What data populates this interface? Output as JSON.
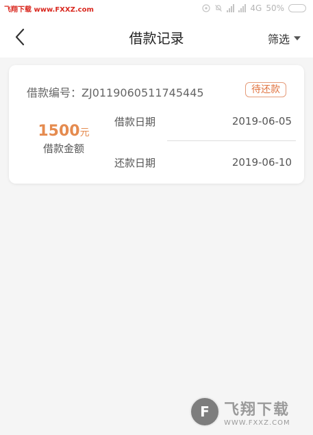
{
  "status_bar": {
    "watermark": "飞翔下载 www.FXXZ.com",
    "network": "4G",
    "battery": "50%",
    "battery_level": 0.5
  },
  "nav": {
    "title": "借款记录",
    "filter_label": "筛选"
  },
  "record": {
    "loan_no_label": "借款编号：",
    "loan_no": "ZJ0119060511745445",
    "status": "待还款",
    "amount": "1500",
    "amount_unit": "元",
    "amount_label": "借款金额",
    "loan_date_label": "借款日期",
    "loan_date": "2019-06-05",
    "repay_date_label": "还款日期",
    "repay_date": "2019-06-10"
  },
  "watermark_bottom": {
    "title": "飞翔下载",
    "url": "WWW.FXXZ.COM"
  },
  "colors": {
    "accent": "#e58b4f",
    "badge_border": "#e59a78",
    "background": "#f5f5f5"
  }
}
